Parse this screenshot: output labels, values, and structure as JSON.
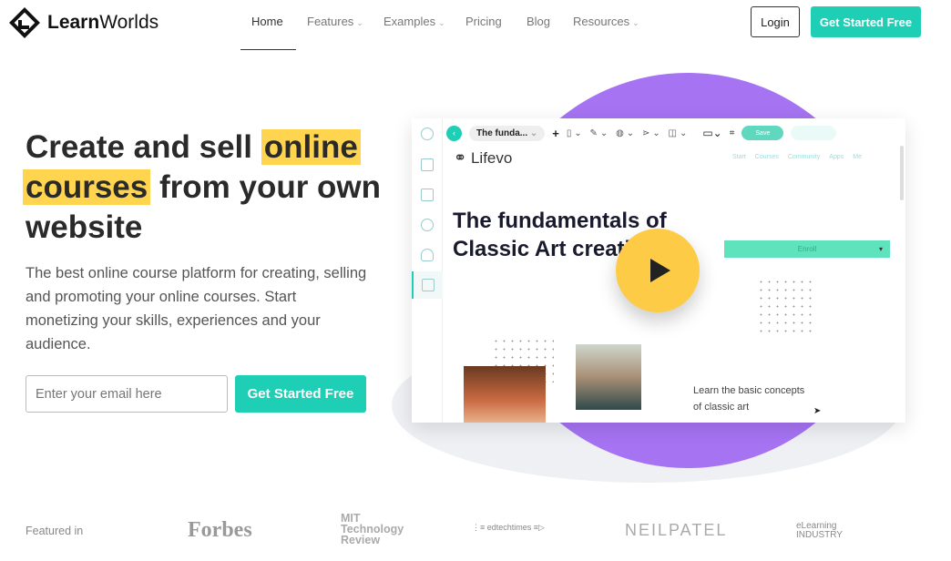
{
  "brand": {
    "name_bold": "Learn",
    "name_rest": "Worlds"
  },
  "nav": {
    "items": [
      {
        "label": "Home",
        "active": true
      },
      {
        "label": "Features",
        "dropdown": true
      },
      {
        "label": "Examples",
        "dropdown": true
      },
      {
        "label": "Pricing"
      },
      {
        "label": "Blog"
      },
      {
        "label": "Resources",
        "dropdown": true
      }
    ],
    "login": "Login",
    "cta": "Get Started Free"
  },
  "hero": {
    "line1_a": "Create and sell ",
    "line1_hl": "online",
    "line2_hl": "courses",
    "line2_b": " from your own",
    "line3": "website",
    "description": "The best online course platform for creating, selling and promoting your online courses. Start monetizing your skills, experiences and your audience.",
    "email_placeholder": "Enter your email here",
    "cta": "Get Started Free"
  },
  "mockup": {
    "page_select": "The funda...",
    "save": "Save",
    "site_logo": "Lifevo",
    "site_nav": [
      "Start",
      "Courses",
      "Community",
      "Apps",
      "Me"
    ],
    "course_title": "The fundamentals of Classic Art creation",
    "enroll": "Enroll",
    "blurb": "Learn the basic concepts of classic art"
  },
  "colors": {
    "teal": "#1fcfb5",
    "yellow": "#ffd54f",
    "purple": "#a673f2"
  },
  "featured": {
    "label": "Featured in",
    "logos": [
      "Forbes",
      "MIT Technology Review",
      "edtechtimes",
      "NEILPATEL",
      "eLearning INDUSTRY"
    ]
  }
}
